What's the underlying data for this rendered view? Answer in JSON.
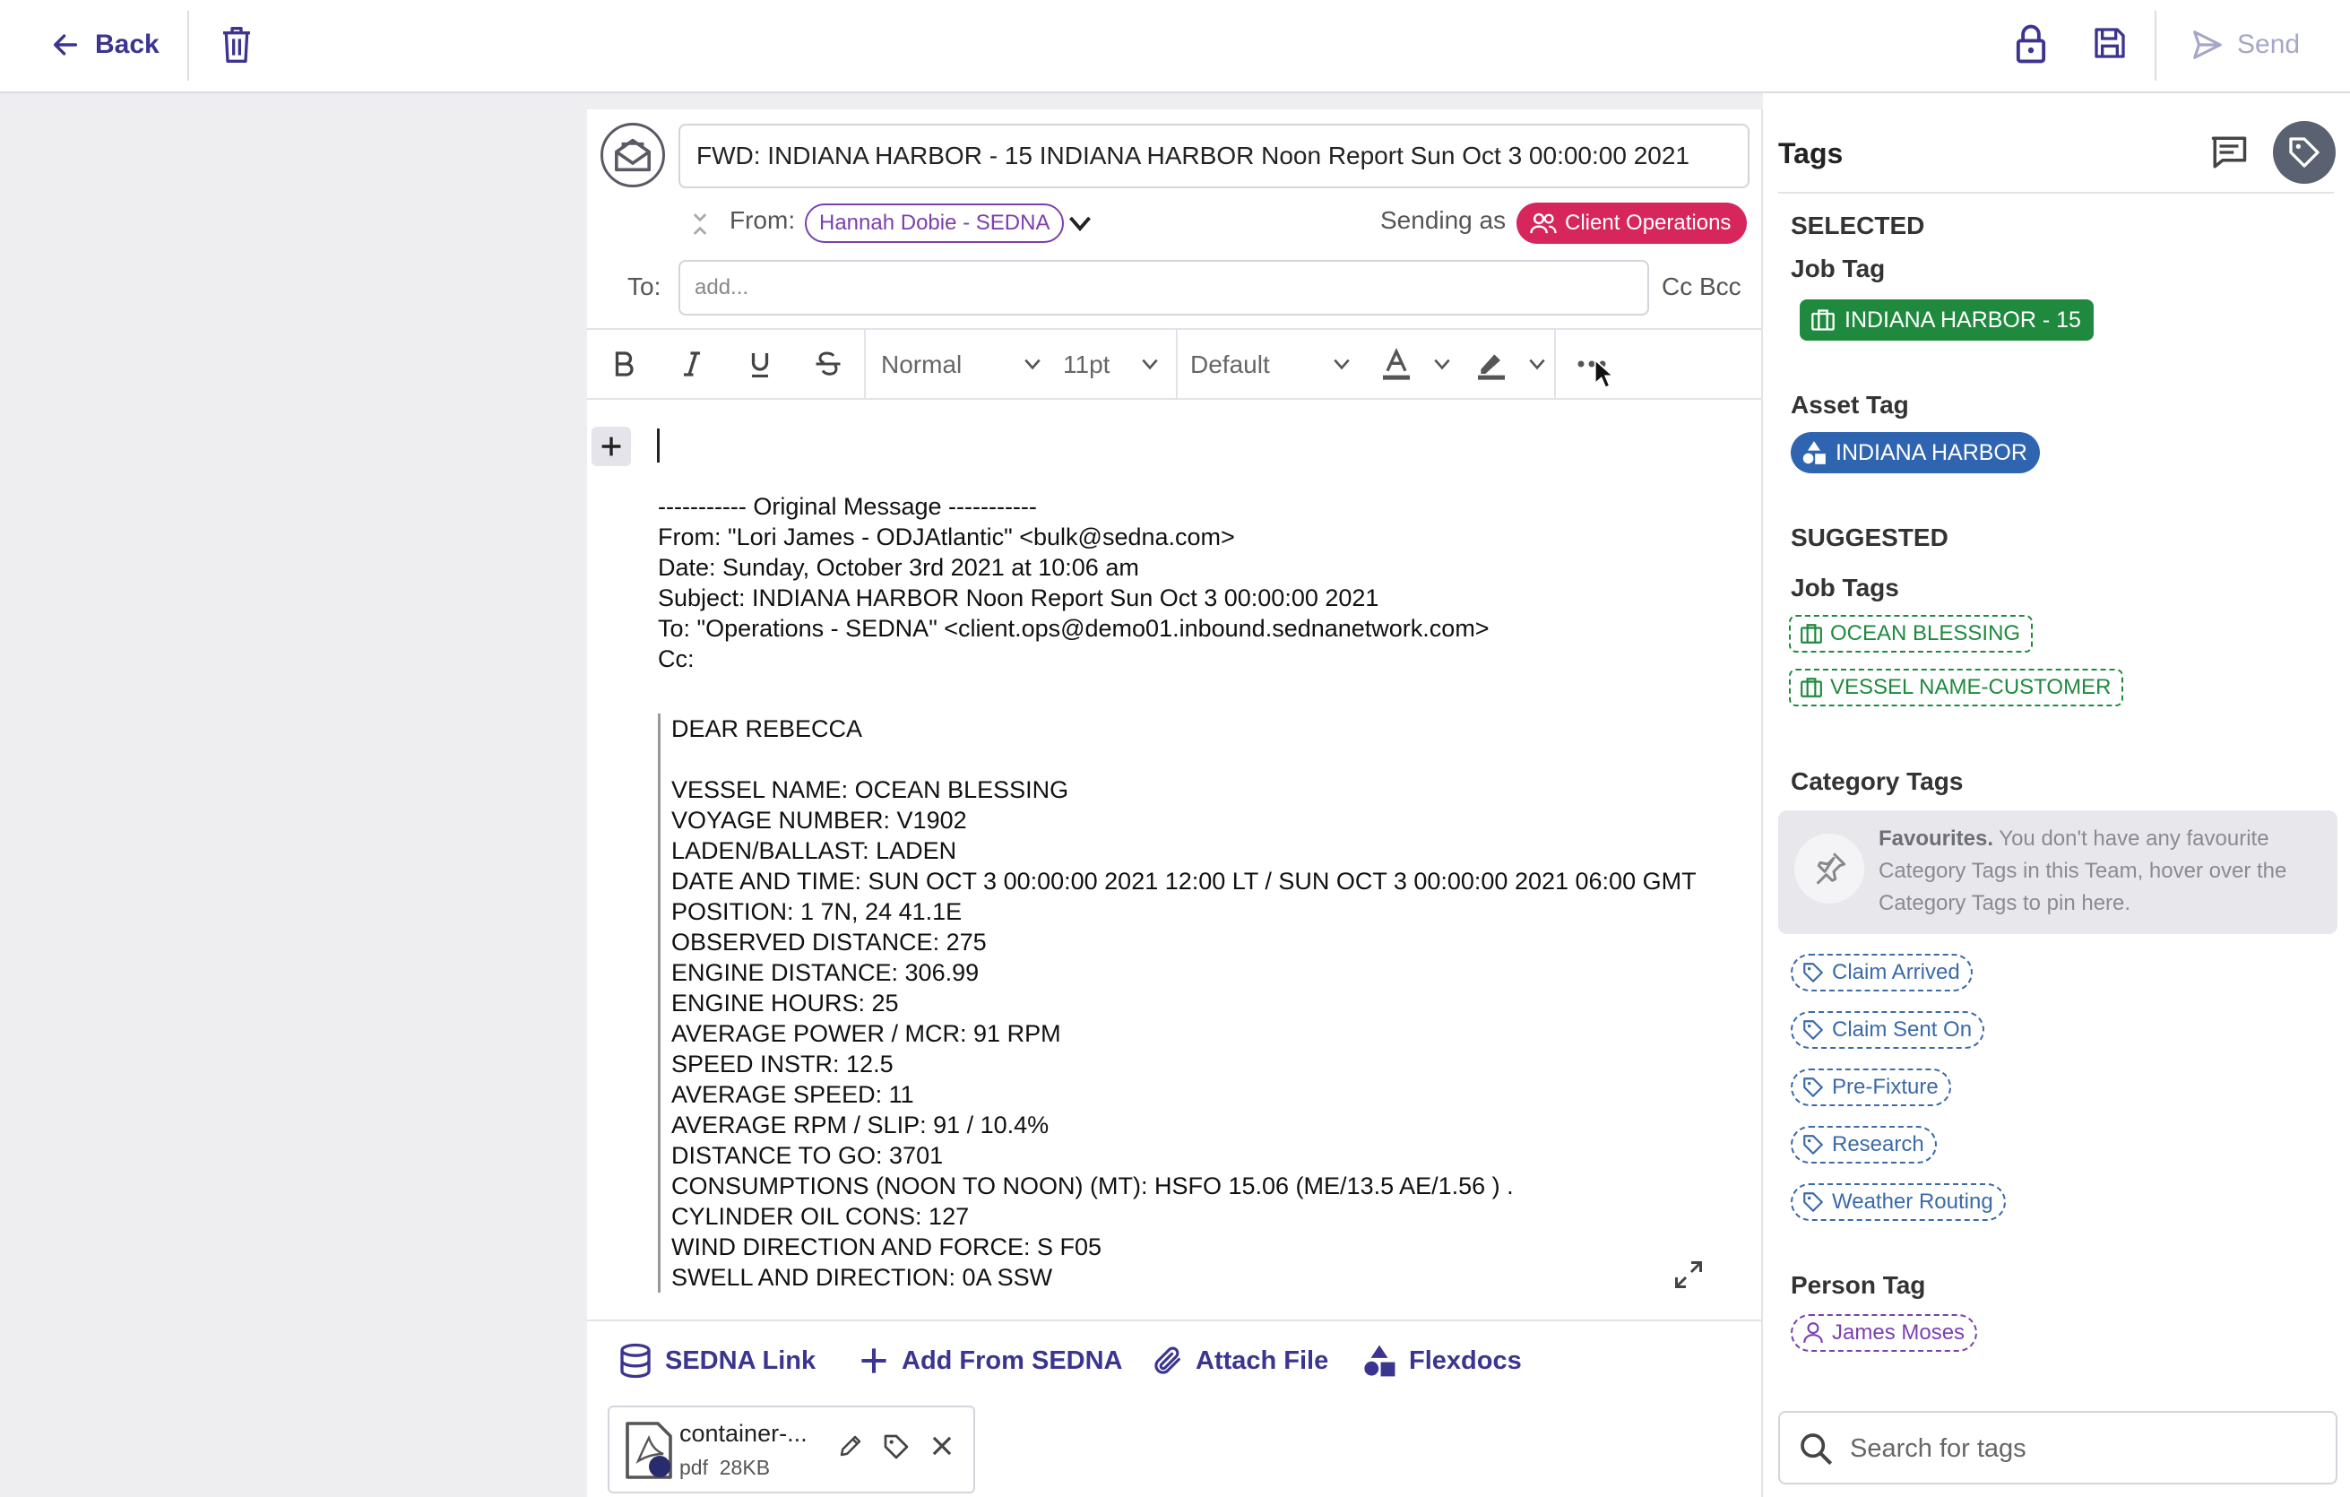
{
  "topbar": {
    "back_label": "Back",
    "send_label": "Send"
  },
  "compose": {
    "subject": "FWD: INDIANA HARBOR - 15 INDIANA HARBOR Noon Report  Sun Oct  3 00:00:00 2021",
    "from_label": "From:",
    "from_value": "Hannah Dobie - SEDNA",
    "sending_as_label": "Sending as",
    "sending_as_value": "Client Operations",
    "to_label": "To:",
    "to_placeholder": "add...",
    "cc_bcc_label": "Cc Bcc",
    "colors": {
      "accent": "#3b3590",
      "client_chip": "#d6265c",
      "from_chip": "#7b3fb0"
    }
  },
  "toolbar": {
    "bold_icon": "bold-icon",
    "italic_icon": "italic-icon",
    "underline_icon": "underline-icon",
    "strike_icon": "strikethrough-icon",
    "style_value": "Normal",
    "size_value": "11pt",
    "font_value": "Default"
  },
  "body": {
    "header_lines": [
      "----------- Original Message -----------",
      "From: \"Lori James - ODJAtlantic\" <bulk@sedna.com>",
      "Date: Sunday, October 3rd 2021 at 10:06 am",
      "Subject: INDIANA HARBOR Noon Report Sun Oct 3 00:00:00 2021",
      "To: \"Operations - SEDNA\" <client.ops@demo01.inbound.sednanetwork.com>",
      "Cc:"
    ],
    "quote_lines": [
      "DEAR REBECCA",
      "",
      "VESSEL NAME: OCEAN BLESSING",
      "VOYAGE NUMBER: V1902",
      "LADEN/BALLAST: LADEN",
      "DATE AND TIME: SUN OCT 3 00:00:00 2021 12:00 LT / SUN OCT 3 00:00:00 2021 06:00 GMT",
      "POSITION: 1 7N, 24 41.1E",
      "OBSERVED DISTANCE: 275",
      "ENGINE DISTANCE: 306.99",
      "ENGINE HOURS: 25",
      "AVERAGE POWER / MCR: 91 RPM",
      "SPEED INSTR: 12.5",
      "AVERAGE SPEED: 11",
      "AVERAGE RPM / SLIP: 91 / 10.4%",
      "DISTANCE TO GO: 3701",
      "CONSUMPTIONS (NOON TO NOON) (MT): HSFO 15.06 (ME/13.5 AE/1.56 ) .",
      "CYLINDER OIL CONS: 127",
      "WIND DIRECTION AND FORCE: S F05",
      "SWELL AND DIRECTION: 0A SSW"
    ]
  },
  "attach_bar": {
    "sedna_link": "SEDNA Link",
    "add_from_sedna": "Add From SEDNA",
    "attach_file": "Attach File",
    "flexdocs": "Flexdocs"
  },
  "attachment": {
    "name": "container-...",
    "type": "pdf",
    "size": "28KB"
  },
  "tags_panel": {
    "title": "Tags",
    "selected_heading": "SELECTED",
    "job_tag_heading": "Job Tag",
    "job_tag": "INDIANA HARBOR - 15",
    "asset_tag_heading": "Asset Tag",
    "asset_tag": "INDIANA HARBOR",
    "suggested_heading": "SUGGESTED",
    "job_tags_heading": "Job Tags",
    "suggested_job_tags": [
      "OCEAN BLESSING",
      "VESSEL NAME-CUSTOMER"
    ],
    "category_tags_heading": "Category Tags",
    "favourites_bold": "Favourites.",
    "favourites_text": " You don't have any favourite Category Tags in this Team, hover over the Category Tags to pin here.",
    "category_tags": [
      "Claim Arrived",
      "Claim Sent On",
      "Pre-Fixture",
      "Research",
      "Weather Routing"
    ],
    "person_tag_heading": "Person Tag",
    "person_tag": "James Moses",
    "search_placeholder": "Search for tags",
    "colors": {
      "job": "#1f8a3e",
      "asset": "#2f64b0",
      "category": "#3a6aa8",
      "person": "#7b3fb0"
    }
  }
}
